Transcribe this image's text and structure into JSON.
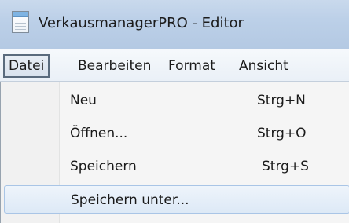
{
  "window": {
    "title": "VerkausmanagerPRO - Editor",
    "icon": "notepad-icon"
  },
  "menubar": {
    "items": [
      {
        "label": "Datei",
        "active": true
      },
      {
        "label": "Bearbeiten"
      },
      {
        "label": "Format"
      },
      {
        "label": "Ansicht"
      }
    ]
  },
  "file_menu": {
    "items": [
      {
        "label": "Neu",
        "shortcut": "Strg+N"
      },
      {
        "label": "Öffnen...",
        "shortcut": "Strg+O"
      },
      {
        "label": "Speichern",
        "shortcut": "Strg+S"
      },
      {
        "label": "Speichern unter...",
        "shortcut": "",
        "highlighted": true
      }
    ]
  },
  "colors": {
    "titlebar": "#bcd0e8",
    "menubar": "#eef3f9",
    "menu_background": "#f5f5f5",
    "highlight": "#dde9f6",
    "highlight_border": "#a9c5e6"
  }
}
